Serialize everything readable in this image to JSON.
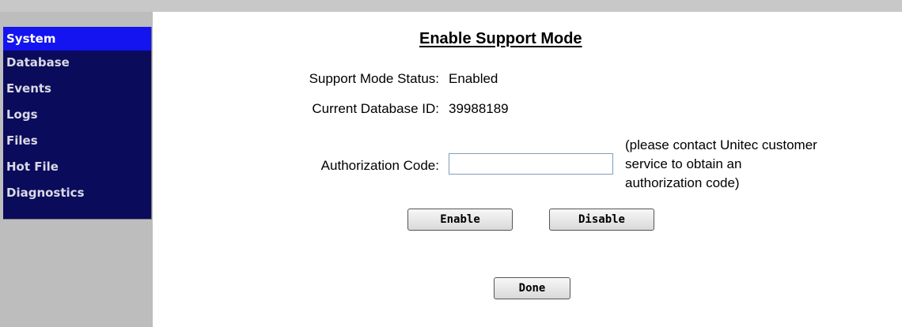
{
  "sidebar": {
    "items": [
      {
        "label": "System"
      },
      {
        "label": "Database"
      },
      {
        "label": "Events"
      },
      {
        "label": "Logs"
      },
      {
        "label": "Files"
      },
      {
        "label": "Hot File"
      },
      {
        "label": "Diagnostics"
      }
    ],
    "active_item": "System",
    "nav_bg_color": "#0b0b5c",
    "active_bg_color": "#1414f0"
  },
  "main": {
    "title": "Enable Support Mode",
    "support_status_label": "Support Mode Status:",
    "support_status_value": "Enabled",
    "database_id_label": "Current Database ID:",
    "database_id_value": "39988189",
    "auth_code_label": "Authorization Code:",
    "auth_code_value": "",
    "auth_note_line1": "(please contact Unitec customer",
    "auth_note_line2": "service to obtain an",
    "auth_note_line3": "authorization code)",
    "enable_label": "Enable",
    "disable_label": "Disable",
    "done_label": "Done"
  }
}
